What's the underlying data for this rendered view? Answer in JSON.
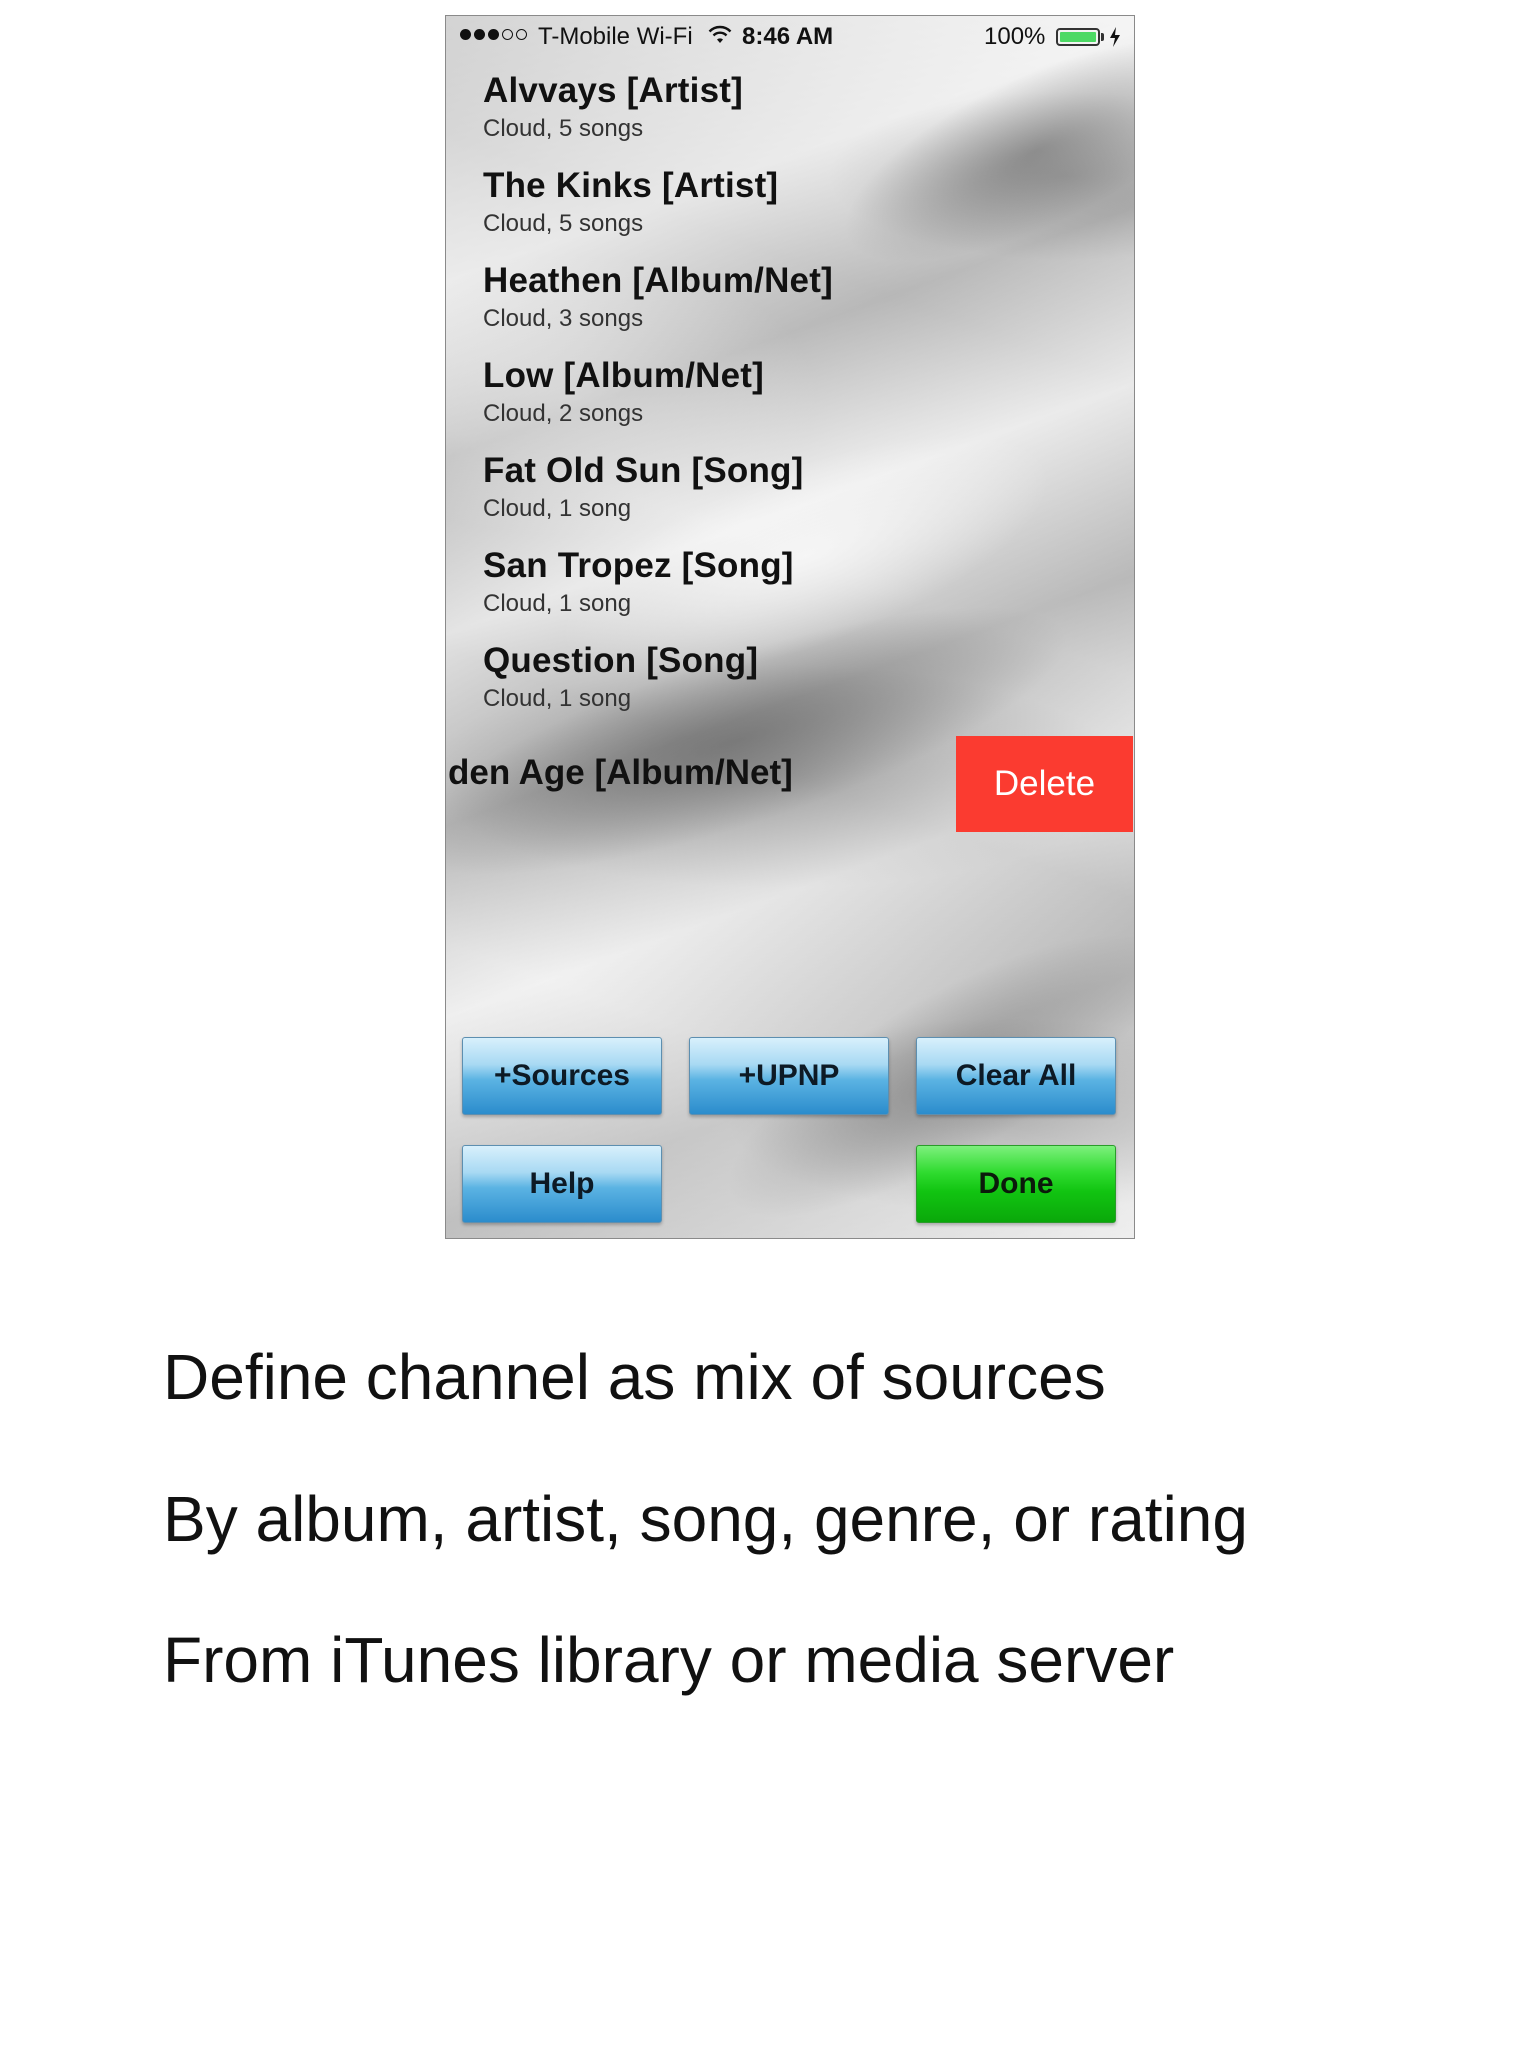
{
  "status_bar": {
    "carrier": "T-Mobile Wi-Fi",
    "time": "8:46 AM",
    "battery": "100%",
    "signal_bars_full": 3,
    "signal_bars_total": 5
  },
  "list": [
    {
      "title": "Alvvays [Artist]",
      "subtitle": "Cloud, 5 songs"
    },
    {
      "title": "The Kinks [Artist]",
      "subtitle": "Cloud, 5 songs"
    },
    {
      "title": "Heathen [Album/Net]",
      "subtitle": "Cloud, 3 songs"
    },
    {
      "title": "Low [Album/Net]",
      "subtitle": "Cloud, 2 songs"
    },
    {
      "title": "Fat Old Sun [Song]",
      "subtitle": "Cloud, 1 song"
    },
    {
      "title": "San Tropez [Song]",
      "subtitle": "Cloud, 1 song"
    },
    {
      "title": "Question [Song]",
      "subtitle": "Cloud, 1 song"
    }
  ],
  "swiped_item": {
    "title_visible": "den Age [Album/Net]",
    "delete_label": "Delete"
  },
  "buttons": {
    "sources": "+Sources",
    "upnp": "+UPNP",
    "clear_all": "Clear All",
    "help": "Help",
    "done": "Done"
  },
  "captions": [
    "Define channel as mix of sources",
    "By album, artist, song, genre, or rating",
    "From iTunes library or media server"
  ],
  "colors": {
    "delete": "#fb3b30",
    "done": "#11c411",
    "button_blue": "#2b8ccc",
    "battery": "#4cd964"
  }
}
